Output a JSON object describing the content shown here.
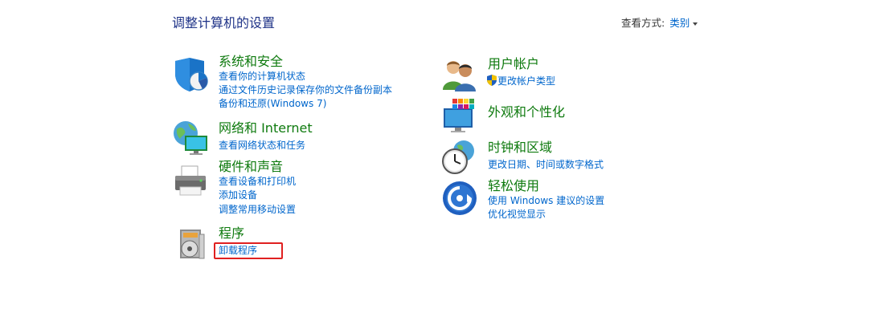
{
  "header": {
    "title": "调整计算机的设置",
    "view_by_label": "查看方式:",
    "view_by_value": "类别"
  },
  "categories": {
    "system_security": {
      "title": "系统和安全",
      "icon": "shield-icon",
      "links": [
        "查看你的计算机状态",
        "通过文件历史记录保存你的文件备份副本",
        "备份和还原(Windows 7)"
      ]
    },
    "network": {
      "title": "网络和 Internet",
      "icon": "network-globe-icon",
      "links": [
        "查看网络状态和任务"
      ]
    },
    "hardware_sound": {
      "title": "硬件和声音",
      "icon": "printer-icon",
      "links": [
        "查看设备和打印机",
        "添加设备",
        "调整常用移动设置"
      ]
    },
    "programs": {
      "title": "程序",
      "icon": "programs-disc-icon",
      "links": [
        "卸载程序"
      ]
    },
    "user_accounts": {
      "title": "用户帐户",
      "icon": "users-icon",
      "links": [
        "更改帐户类型"
      ]
    },
    "appearance": {
      "title": "外观和个性化",
      "icon": "monitor-palette-icon",
      "links": []
    },
    "clock_region": {
      "title": "时钟和区域",
      "icon": "clock-globe-icon",
      "links": [
        "更改日期、时间或数字格式"
      ]
    },
    "ease_of_access": {
      "title": "轻松使用",
      "icon": "ease-of-access-icon",
      "links": [
        "使用 Windows 建议的设置",
        "优化视觉显示"
      ]
    }
  },
  "colors": {
    "category_title": "#0e7a0e",
    "link": "#0066cc",
    "header_title": "#1e3287",
    "highlight": "#e02020"
  }
}
